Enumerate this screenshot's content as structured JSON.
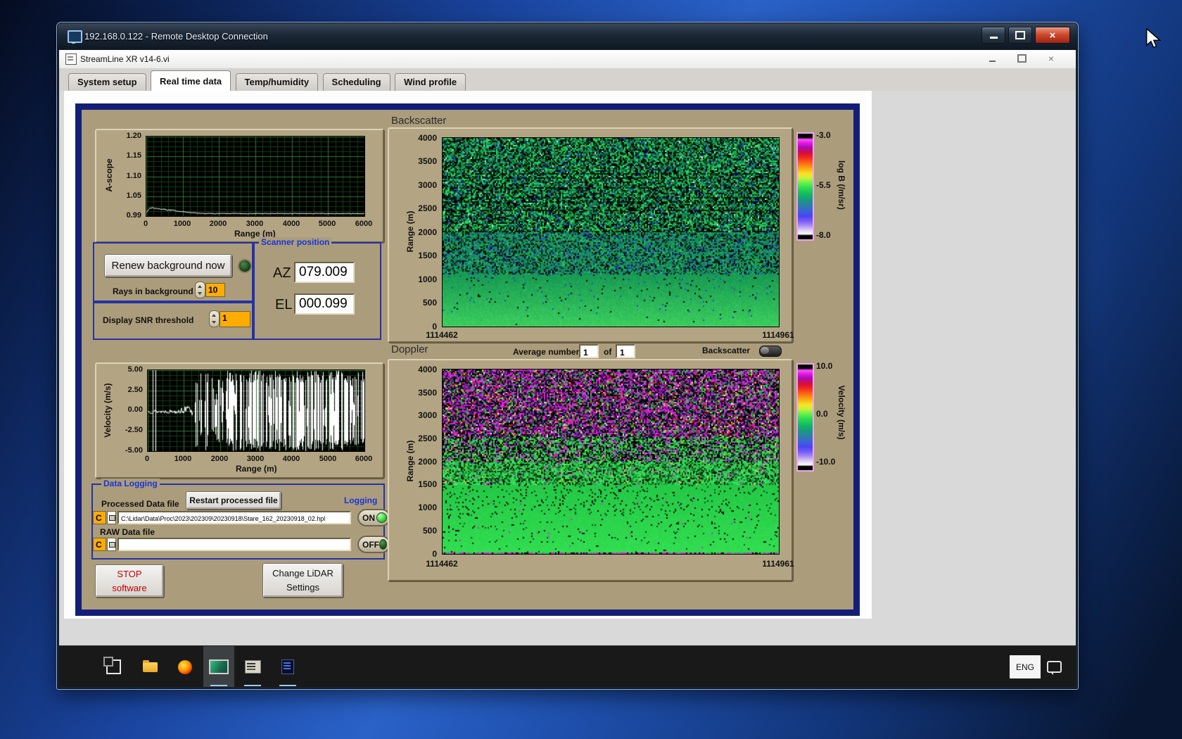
{
  "rdp": {
    "title": "192.168.0.122 - Remote Desktop Connection"
  },
  "app": {
    "title": "StreamLine XR v14-6.vi"
  },
  "tabs": {
    "items": [
      "System setup",
      "Real time data",
      "Temp/humidity",
      "Scheduling",
      "Wind profile"
    ],
    "active": "Real time data"
  },
  "ascope": {
    "ylabel": "A-scope",
    "yticks": [
      "1.20",
      "1.15",
      "1.10",
      "1.05",
      "0.99"
    ],
    "xticks": [
      "0",
      "1000",
      "2000",
      "3000",
      "4000",
      "5000",
      "6000"
    ],
    "xlabel": "Range (m)"
  },
  "controls": {
    "renew_button": "Renew background now",
    "rays_label": "Rays in background",
    "rays_value": "10",
    "snr_label": "Display SNR threshold",
    "snr_value": "1"
  },
  "scanner": {
    "title": "Scanner position",
    "az_label": "AZ",
    "az_value": "079.009",
    "el_label": "EL",
    "el_value": "000.099"
  },
  "velocity": {
    "ylabel": "Velocity (m/s)",
    "yticks": [
      "5.00",
      "2.50",
      "0.00",
      "-2.50",
      "-5.00"
    ],
    "xticks": [
      "0",
      "1000",
      "2000",
      "3000",
      "4000",
      "5000",
      "6000"
    ],
    "xlabel": "Range (m)"
  },
  "backscatter": {
    "title": "Backscatter",
    "ylabel": "Range (m)",
    "yticks": [
      "4000",
      "3500",
      "3000",
      "2500",
      "2000",
      "1500",
      "1000",
      "500",
      "0"
    ],
    "x_start": "1114462",
    "x_end": "1114961",
    "cbar_ticks": [
      "-3.0",
      "-5.5",
      "-8.0"
    ],
    "cbar_label": "log B (/m/sr)"
  },
  "doppler": {
    "title": "Doppler",
    "avg_label": "Average number",
    "avg_value": "1",
    "of_label": "of",
    "avg_total": "1",
    "toggle_label": "Backscatter",
    "ylabel": "Range (m)",
    "yticks": [
      "4000",
      "3500",
      "3000",
      "2500",
      "2000",
      "1500",
      "1000",
      "500",
      "0"
    ],
    "x_start": "1114462",
    "x_end": "1114961",
    "cbar_ticks": [
      "10.0",
      "0.0",
      "-10.0"
    ],
    "cbar_label": "Velocity (m/s)"
  },
  "logging": {
    "title": "Data Logging",
    "processed_label": "Processed Data file",
    "restart_button": "Restart processed file",
    "logging_label": "Logging",
    "drive": "C",
    "processed_path": "C:\\Lidar\\Data\\Proc\\2023\\202309\\20230918\\Stare_162_20230918_02.hpl",
    "on_label": "ON",
    "raw_label": "RAW Data file",
    "raw_path": "",
    "off_label": "OFF"
  },
  "actions": {
    "stop_line1": "STOP",
    "stop_line2": "software",
    "change_line1": "Change LiDAR",
    "change_line2": "Settings"
  },
  "taskbar": {
    "language": "ENG"
  },
  "colors": {
    "panel_tan": "#ab9d7b",
    "panel_border_navy": "#141e78",
    "group_border_blue": "#2433a8",
    "label_blue": "#1a35d6",
    "value_orange": "#ffac00",
    "led_on": "#39d839",
    "led_off": "#1e5a1e",
    "stop_red": "#c00000"
  }
}
